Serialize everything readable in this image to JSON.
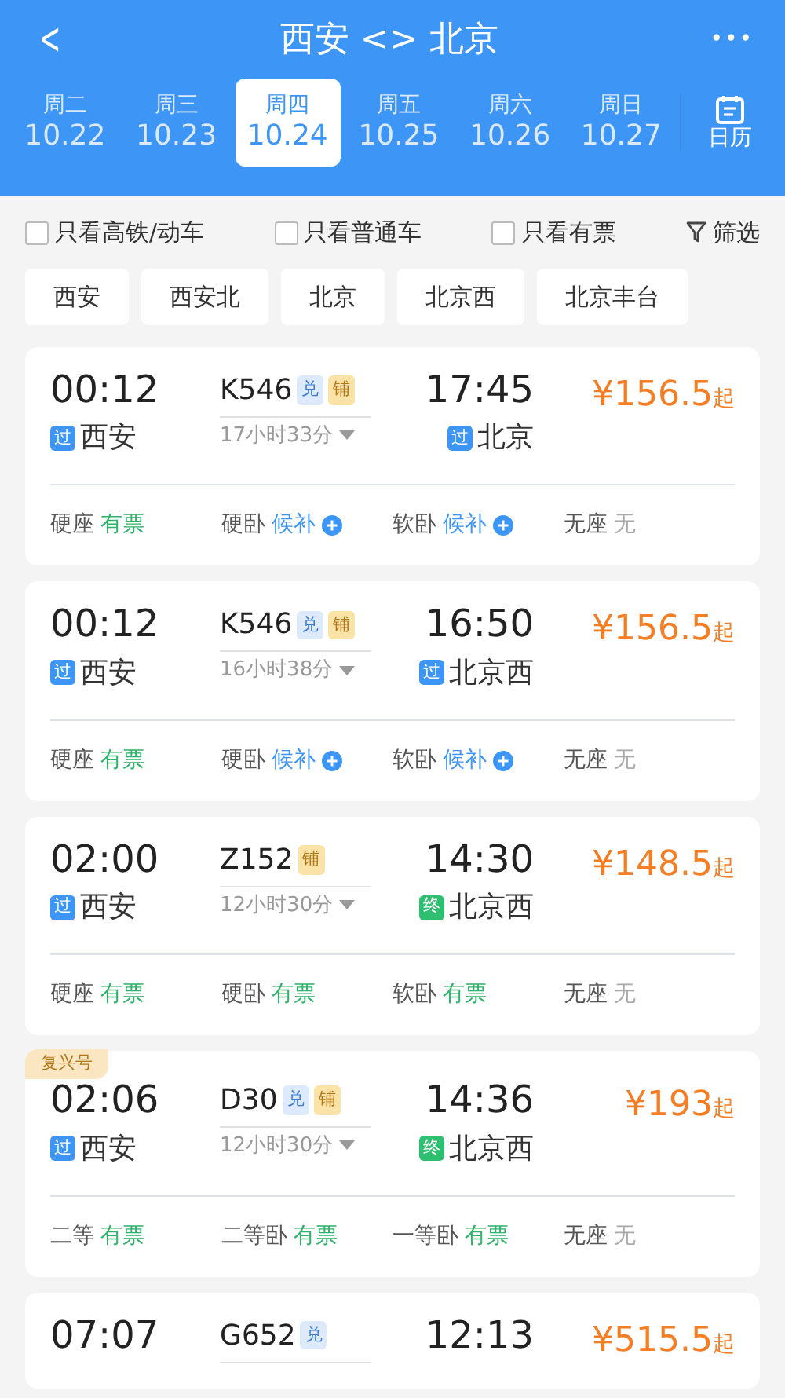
{
  "title": "西安 <> 北京",
  "back": "<",
  "more": "•••",
  "dates": [
    {
      "weekday": "周二",
      "date": "10.22",
      "selected": false
    },
    {
      "weekday": "周三",
      "date": "10.23",
      "selected": false
    },
    {
      "weekday": "周四",
      "date": "10.24",
      "selected": true
    },
    {
      "weekday": "周五",
      "date": "10.25",
      "selected": false
    },
    {
      "weekday": "周六",
      "date": "10.26",
      "selected": false
    },
    {
      "weekday": "周日",
      "date": "10.27",
      "selected": false
    }
  ],
  "calendar": "日历",
  "filters": [
    {
      "label": "只看高铁/动车",
      "checked": false
    },
    {
      "label": "只看普通车",
      "checked": false
    },
    {
      "label": "只看有票",
      "checked": false
    }
  ],
  "filter_button": "筛选",
  "stations": [
    "西安",
    "西安北",
    "北京",
    "北京西",
    "北京丰台"
  ],
  "trains": [
    {
      "depart_time": "00:12",
      "depart_mark": {
        "text": "过",
        "kind": "pass"
      },
      "depart_station": "西安",
      "train_no": "K546",
      "badges": [
        {
          "text": "兑",
          "kind": "exchange"
        },
        {
          "text": "铺",
          "kind": "berth"
        }
      ],
      "duration": "17小时33分",
      "arrive_time": "17:45",
      "arrive_mark": {
        "text": "过",
        "kind": "pass"
      },
      "arrive_station": "北京",
      "price": "¥156.5",
      "price_suffix": "起",
      "seats": [
        {
          "class": "硬座",
          "status": "有票",
          "kind": "available"
        },
        {
          "class": "硬卧",
          "status": "候补",
          "kind": "waitlist"
        },
        {
          "class": "软卧",
          "status": "候补",
          "kind": "waitlist"
        },
        {
          "class": "无座",
          "status": "无",
          "kind": "none"
        }
      ]
    },
    {
      "depart_time": "00:12",
      "depart_mark": {
        "text": "过",
        "kind": "pass"
      },
      "depart_station": "西安",
      "train_no": "K546",
      "badges": [
        {
          "text": "兑",
          "kind": "exchange"
        },
        {
          "text": "铺",
          "kind": "berth"
        }
      ],
      "duration": "16小时38分",
      "arrive_time": "16:50",
      "arrive_mark": {
        "text": "过",
        "kind": "pass"
      },
      "arrive_station": "北京西",
      "price": "¥156.5",
      "price_suffix": "起",
      "seats": [
        {
          "class": "硬座",
          "status": "有票",
          "kind": "available"
        },
        {
          "class": "硬卧",
          "status": "候补",
          "kind": "waitlist"
        },
        {
          "class": "软卧",
          "status": "候补",
          "kind": "waitlist"
        },
        {
          "class": "无座",
          "status": "无",
          "kind": "none"
        }
      ]
    },
    {
      "depart_time": "02:00",
      "depart_mark": {
        "text": "过",
        "kind": "pass"
      },
      "depart_station": "西安",
      "train_no": "Z152",
      "badges": [
        {
          "text": "铺",
          "kind": "berth"
        }
      ],
      "duration": "12小时30分",
      "arrive_time": "14:30",
      "arrive_mark": {
        "text": "终",
        "kind": "terminal"
      },
      "arrive_station": "北京西",
      "price": "¥148.5",
      "price_suffix": "起",
      "seats": [
        {
          "class": "硬座",
          "status": "有票",
          "kind": "available"
        },
        {
          "class": "硬卧",
          "status": "有票",
          "kind": "available"
        },
        {
          "class": "软卧",
          "status": "有票",
          "kind": "available"
        },
        {
          "class": "无座",
          "status": "无",
          "kind": "none"
        }
      ]
    },
    {
      "tag": "复兴号",
      "depart_time": "02:06",
      "depart_mark": {
        "text": "过",
        "kind": "pass"
      },
      "depart_station": "西安",
      "train_no": "D30",
      "badges": [
        {
          "text": "兑",
          "kind": "exchange"
        },
        {
          "text": "铺",
          "kind": "berth"
        }
      ],
      "duration": "12小时30分",
      "arrive_time": "14:36",
      "arrive_mark": {
        "text": "终",
        "kind": "terminal"
      },
      "arrive_station": "北京西",
      "price": "¥193",
      "price_suffix": "起",
      "seats": [
        {
          "class": "二等",
          "status": "有票",
          "kind": "available"
        },
        {
          "class": "二等卧",
          "status": "有票",
          "kind": "available"
        },
        {
          "class": "一等卧",
          "status": "有票",
          "kind": "available"
        },
        {
          "class": "无座",
          "status": "无",
          "kind": "none"
        }
      ]
    },
    {
      "depart_time": "07:07",
      "train_no": "G652",
      "badges": [
        {
          "text": "兑",
          "kind": "exchange"
        }
      ],
      "arrive_time": "12:13",
      "price": "¥515.5",
      "price_suffix": "起"
    }
  ]
}
